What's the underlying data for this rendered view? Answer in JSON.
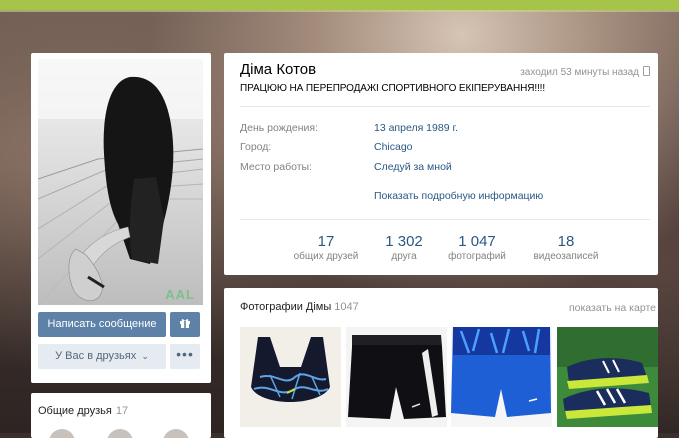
{
  "colors": {
    "accent_bar": "#a7c44a",
    "button_primary": "#5e81a8",
    "button_secondary": "#e5ebf1",
    "link": "#2a5885",
    "muted": "#828282"
  },
  "profile": {
    "name": "Діма Котов",
    "last_seen": "заходил 53 минуты назад",
    "status": "ПРАЦЮЮ НА ПЕРЕПРОДАЖІ СПОРТИВНОГО ЕКІПЕРУВАННЯ!!!!",
    "info": [
      {
        "label": "День рождения:",
        "value": "13 апреля 1989 г."
      },
      {
        "label": "Город:",
        "value": "Chicago"
      },
      {
        "label": "Место работы:",
        "value": "Следуй за мной"
      }
    ],
    "show_more": "Показать подробную информацию",
    "counters": [
      {
        "value": "17",
        "label": "общих друзей"
      },
      {
        "value": "1 302",
        "label": "друга"
      },
      {
        "value": "1 047",
        "label": "фотографий"
      },
      {
        "value": "18",
        "label": "видеозаписей"
      }
    ]
  },
  "avatar": {
    "watermark": "AAL"
  },
  "actions": {
    "message_label": "Написать сообщение",
    "gift_icon": "gift-icon",
    "friends_label": "У Вас в друзьях",
    "friends_chevron": "⌄",
    "more_label": "•••"
  },
  "common_friends": {
    "title": "Общие друзья",
    "count": "17"
  },
  "photos": {
    "title": "Фотографии Дімы",
    "count": "1047",
    "map_link": "показать на карте",
    "items": [
      {
        "icon": "sports-bra-photo"
      },
      {
        "icon": "black-shorts-photo"
      },
      {
        "icon": "blue-shorts-photo"
      },
      {
        "icon": "sneakers-photo"
      }
    ]
  }
}
